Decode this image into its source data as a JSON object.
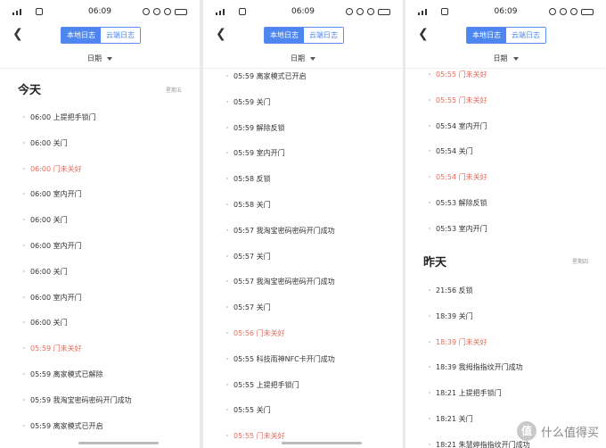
{
  "status_bar": {
    "time": "06:09"
  },
  "header": {
    "tab_local": "本地日志",
    "tab_cloud": "云端日志",
    "filter_label": "日期"
  },
  "panel1": {
    "section_title": "今天",
    "section_weekday": "星期五",
    "entries": [
      {
        "text": "06:00 上提把手锁门",
        "alert": false
      },
      {
        "text": "06:00 关门",
        "alert": false
      },
      {
        "text": "06:00 门未关好",
        "alert": true
      },
      {
        "text": "06:00 室内开门",
        "alert": false
      },
      {
        "text": "06:00 关门",
        "alert": false
      },
      {
        "text": "06:00 室内开门",
        "alert": false
      },
      {
        "text": "06:00 关门",
        "alert": false
      },
      {
        "text": "06:00 室内开门",
        "alert": false
      },
      {
        "text": "06:00 关门",
        "alert": false
      },
      {
        "text": "05:59 门未关好",
        "alert": true
      },
      {
        "text": "05:59 离家模式已解除",
        "alert": false
      },
      {
        "text": "05:59 我淘宝密码密码开门成功",
        "alert": false
      },
      {
        "text": "05:59 离家模式已开启",
        "alert": false
      }
    ]
  },
  "panel2": {
    "entries": [
      {
        "text": "05:59 离家模式已开启",
        "alert": false
      },
      {
        "text": "05:59 关门",
        "alert": false
      },
      {
        "text": "05:59 解除反锁",
        "alert": false
      },
      {
        "text": "05:59 室内开门",
        "alert": false
      },
      {
        "text": "05:58 反锁",
        "alert": false
      },
      {
        "text": "05:58 关门",
        "alert": false
      },
      {
        "text": "05:57 我淘宝密码密码开门成功",
        "alert": false
      },
      {
        "text": "05:57 关门",
        "alert": false
      },
      {
        "text": "05:57 我淘宝密码密码开门成功",
        "alert": false
      },
      {
        "text": "05:57 关门",
        "alert": false
      },
      {
        "text": "05:56 门未关好",
        "alert": true
      },
      {
        "text": "05:55 科技雨神NFC卡开门成功",
        "alert": false
      },
      {
        "text": "05:55 上提把手锁门",
        "alert": false
      },
      {
        "text": "05:55 关门",
        "alert": false
      },
      {
        "text": "05:55 门未关好",
        "alert": true
      }
    ]
  },
  "panel3": {
    "entries_top": [
      {
        "text": "05:55 门未关好",
        "alert": true
      },
      {
        "text": "05:55 门未关好",
        "alert": true
      },
      {
        "text": "05:54 室内开门",
        "alert": false
      },
      {
        "text": "05:54 关门",
        "alert": false
      },
      {
        "text": "05:54 门未关好",
        "alert": true
      },
      {
        "text": "05:53 解除反锁",
        "alert": false
      },
      {
        "text": "05:53 室内开门",
        "alert": false
      }
    ],
    "section_title": "昨天",
    "section_weekday": "星期四",
    "entries_bottom": [
      {
        "text": "21:56 反锁",
        "alert": false
      },
      {
        "text": "18:39 关门",
        "alert": false
      },
      {
        "text": "18:39 门未关好",
        "alert": true
      },
      {
        "text": "18:39 我拇指指纹开门成功",
        "alert": false
      },
      {
        "text": "18:21 上提把手锁门",
        "alert": false
      },
      {
        "text": "18:21 关门",
        "alert": false
      },
      {
        "text": "18:21 朱慧婷指指纹开门成功",
        "alert": false
      }
    ]
  },
  "watermark": {
    "logo_char": "值",
    "text": "什么值得买"
  }
}
